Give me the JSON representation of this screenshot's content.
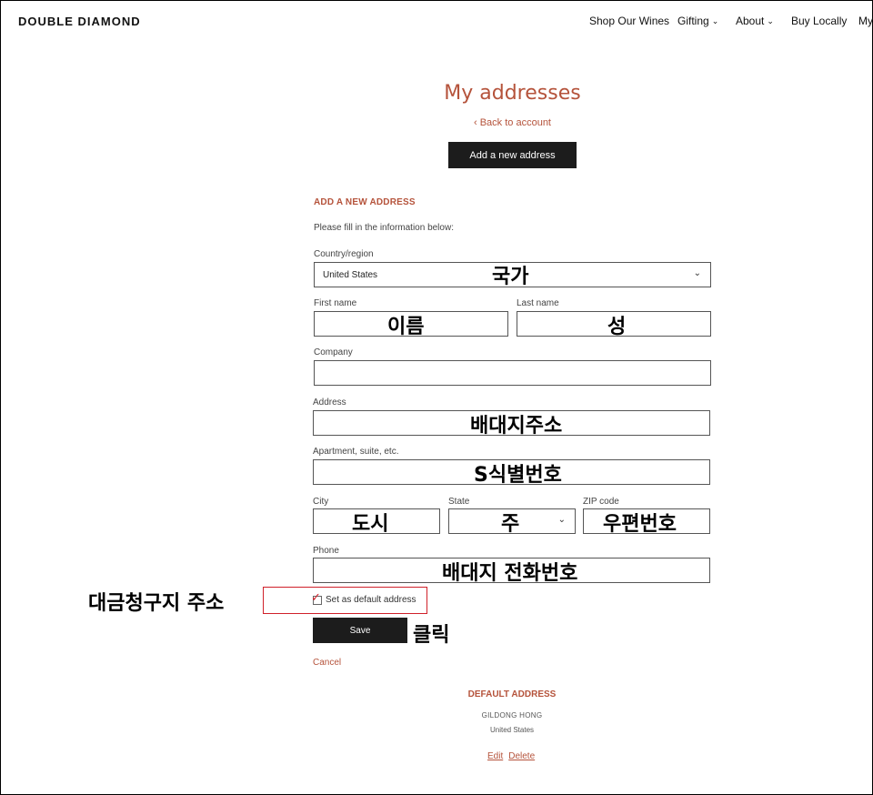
{
  "header": {
    "logo": "DOUBLE DIAMOND",
    "nav": [
      "Shop Our Wines",
      "Gifting",
      "About",
      "Buy Locally",
      "My"
    ]
  },
  "page": {
    "title": "My addresses",
    "back_link": "Back to account",
    "add_button": "Add a new address"
  },
  "form": {
    "section_title": "ADD A NEW ADDRESS",
    "intro": "Please fill in the information below:",
    "country_label": "Country/region",
    "country_value": "United States",
    "first_name_label": "First name",
    "last_name_label": "Last name",
    "company_label": "Company",
    "address_label": "Address",
    "apartment_label": "Apartment, suite, etc.",
    "city_label": "City",
    "state_label": "State",
    "zip_label": "ZIP code",
    "phone_label": "Phone",
    "default_checkbox_label": "Set as default address",
    "save_button": "Save",
    "cancel_link": "Cancel"
  },
  "annotations": {
    "country": "국가",
    "first_name": "이름",
    "last_name": "성",
    "address": "배대지주소",
    "apartment": "S식별번호",
    "city": "도시",
    "state": "주",
    "zip": "우편번호",
    "phone": "배대지 전화번호",
    "billing": "대금청구지 주소",
    "click": "클릭"
  },
  "default_address": {
    "title": "DEFAULT ADDRESS",
    "name": "GILDONG HONG",
    "country": "United States",
    "edit": "Edit",
    "delete": "Delete"
  },
  "colors": {
    "accent": "#b5533b",
    "button": "#1c1c1c",
    "highlight": "#d0202a"
  }
}
